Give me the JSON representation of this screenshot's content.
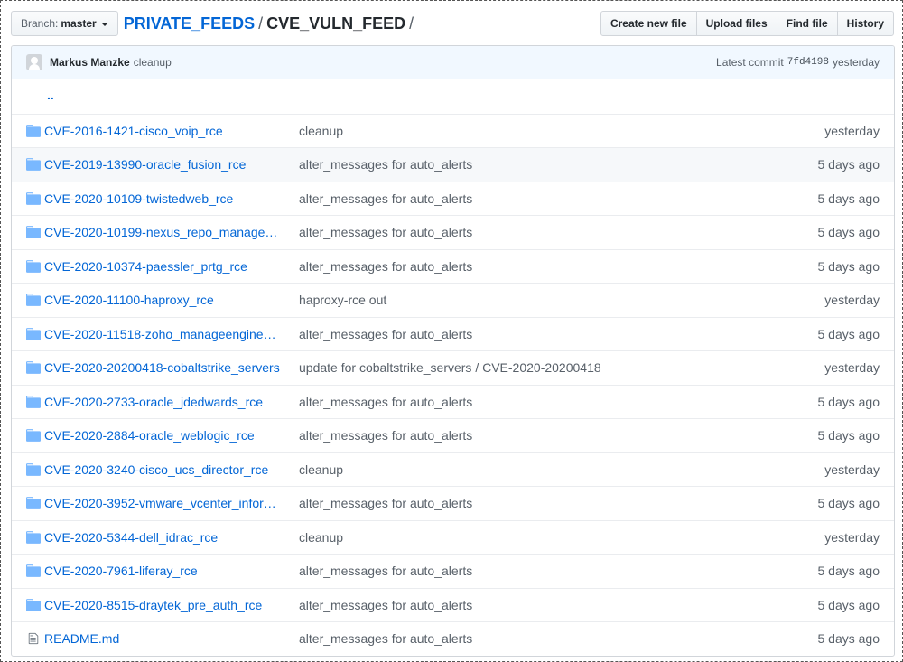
{
  "branch": {
    "prefix": "Branch:",
    "name": "master"
  },
  "breadcrumb": {
    "repo": "PRIVATE_FEEDS",
    "sep1": "/",
    "dir": "CVE_VULN_FEED",
    "sep2": "/"
  },
  "actions": {
    "create": "Create new file",
    "upload": "Upload files",
    "find": "Find file",
    "history": "History"
  },
  "latest_commit": {
    "author": "Markus Manzke",
    "message": "cleanup",
    "label": "Latest commit",
    "sha": "7fd4198",
    "date": "yesterday"
  },
  "parent_link": "..",
  "files": [
    {
      "name": "CVE-2016-1421-cisco_voip_rce",
      "message": "cleanup",
      "age": "yesterday",
      "icon": "folder-icon"
    },
    {
      "name": "CVE-2019-13990-oracle_fusion_rce",
      "message": "alter_messages for auto_alerts",
      "age": "5 days ago",
      "icon": "folder-icon"
    },
    {
      "name": "CVE-2020-10109-twistedweb_rce",
      "message": "alter_messages for auto_alerts",
      "age": "5 days ago",
      "icon": "folder-icon"
    },
    {
      "name": "CVE-2020-10199-nexus_repo_manage…",
      "message": "alter_messages for auto_alerts",
      "age": "5 days ago",
      "icon": "folder-icon"
    },
    {
      "name": "CVE-2020-10374-paessler_prtg_rce",
      "message": "alter_messages for auto_alerts",
      "age": "5 days ago",
      "icon": "folder-icon"
    },
    {
      "name": "CVE-2020-11100-haproxy_rce",
      "message": "haproxy-rce out",
      "age": "yesterday",
      "icon": "folder-icon"
    },
    {
      "name": "CVE-2020-11518-zoho_manageengine…",
      "message": "alter_messages for auto_alerts",
      "age": "5 days ago",
      "icon": "folder-icon"
    },
    {
      "name": "CVE-2020-20200418-cobaltstrike_servers",
      "message": "update for cobaltstrike_servers / CVE-2020-20200418",
      "age": "yesterday",
      "icon": "folder-icon"
    },
    {
      "name": "CVE-2020-2733-oracle_jdedwards_rce",
      "message": "alter_messages for auto_alerts",
      "age": "5 days ago",
      "icon": "folder-icon"
    },
    {
      "name": "CVE-2020-2884-oracle_weblogic_rce",
      "message": "alter_messages for auto_alerts",
      "age": "5 days ago",
      "icon": "folder-icon"
    },
    {
      "name": "CVE-2020-3240-cisco_ucs_director_rce",
      "message": "cleanup",
      "age": "yesterday",
      "icon": "folder-icon"
    },
    {
      "name": "CVE-2020-3952-vmware_vcenter_infor…",
      "message": "alter_messages for auto_alerts",
      "age": "5 days ago",
      "icon": "folder-icon"
    },
    {
      "name": "CVE-2020-5344-dell_idrac_rce",
      "message": "cleanup",
      "age": "yesterday",
      "icon": "folder-icon"
    },
    {
      "name": "CVE-2020-7961-liferay_rce",
      "message": "alter_messages for auto_alerts",
      "age": "5 days ago",
      "icon": "folder-icon"
    },
    {
      "name": "CVE-2020-8515-draytek_pre_auth_rce",
      "message": "alter_messages for auto_alerts",
      "age": "5 days ago",
      "icon": "folder-icon"
    },
    {
      "name": "README.md",
      "message": "alter_messages for auto_alerts",
      "age": "5 days ago",
      "icon": "file-icon"
    }
  ],
  "colors": {
    "link": "#0366d6",
    "icon": "#79b8ff",
    "muted": "#586069",
    "commit_bar": "#f1f8ff"
  }
}
